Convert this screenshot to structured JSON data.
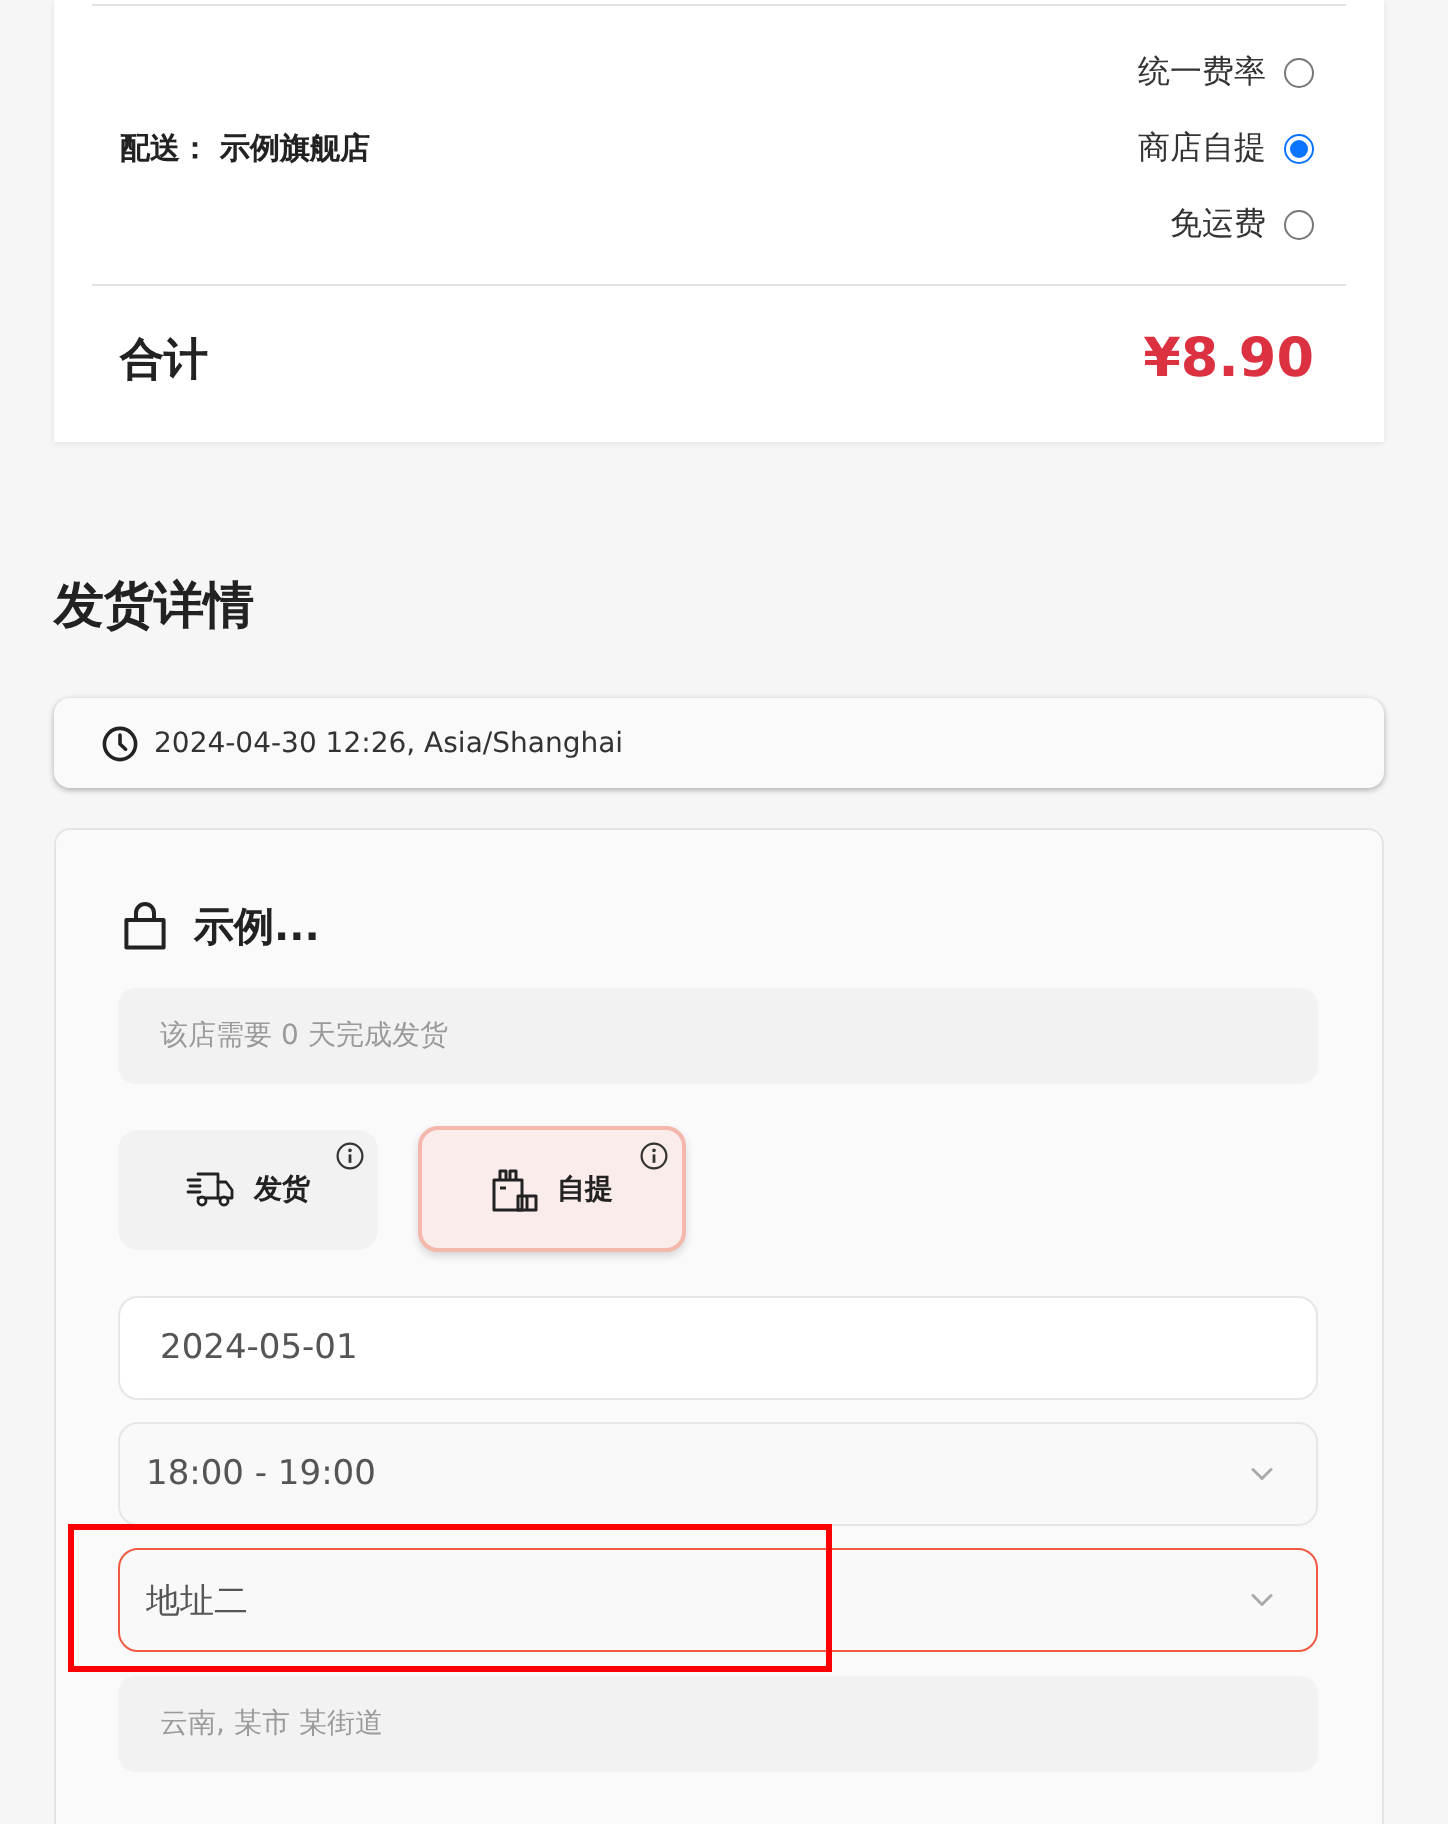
{
  "order_summary": {
    "shipping": {
      "label": "配送：",
      "store": "示例旗舰店",
      "options": [
        {
          "label": "统一费率",
          "selected": false
        },
        {
          "label": "商店自提",
          "selected": true
        },
        {
          "label": "免运费",
          "selected": false
        }
      ]
    },
    "total": {
      "label": "合计",
      "amount": "¥8.90"
    }
  },
  "shipping_details": {
    "title": "发货详情",
    "timestamp": "2024-04-30 12:26, Asia/Shanghai",
    "store": {
      "name": "示例...",
      "note": "该店需要 0 天完成发货",
      "methods": [
        {
          "kind": "delivery",
          "label": "发货",
          "selected": false
        },
        {
          "kind": "pickup",
          "label": "自提",
          "selected": true
        }
      ],
      "date": {
        "value": "2024-05-01"
      },
      "time_slot": {
        "value": "18:00 - 19:00",
        "focused": false
      },
      "address": {
        "value": "地址二",
        "focused": true,
        "highlighted": true
      },
      "address_detail": "云南, 某市 某街道"
    }
  }
}
